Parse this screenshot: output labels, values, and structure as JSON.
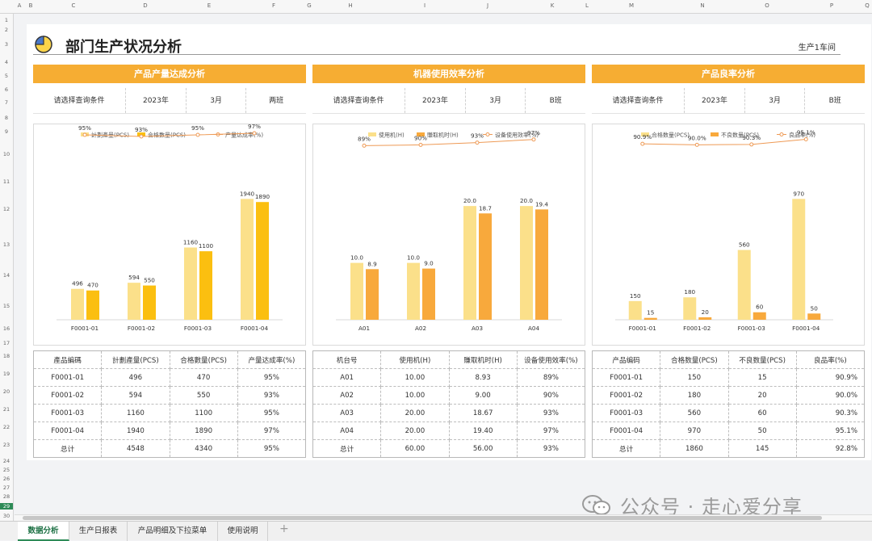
{
  "columns": [
    "A",
    "B",
    "C",
    "D",
    "E",
    "F",
    "G",
    "H",
    "I",
    "J",
    "K",
    "L",
    "M",
    "N",
    "O",
    "P",
    "Q"
  ],
  "rows": [
    "1",
    "2",
    "3",
    "4",
    "5",
    "6",
    "7",
    "8",
    "9",
    "10",
    "11",
    "12",
    "13",
    "14",
    "15",
    "16",
    "17",
    "18",
    "19",
    "20",
    "21",
    "22",
    "23",
    "24",
    "25",
    "26",
    "27",
    "28",
    "29",
    "30"
  ],
  "selected_row": "29",
  "title": "部门生产状况分析",
  "workshop": "生产1车间",
  "colors": {
    "accent": "#f6ad33",
    "bar_light": "#fbe08a",
    "bar_gold": "#fbbf10",
    "bar_orange": "#f8a93c",
    "line": "#ee9a55"
  },
  "panels": [
    {
      "header": "产品产量达成分析",
      "filters": [
        "请选择查询条件",
        "2023年",
        "3月",
        "两班"
      ],
      "table": {
        "columns": [
          "產品編碼",
          "計劃產量(PCS)",
          "合格數量(PCS)",
          "产量达成率(%)"
        ],
        "rows": [
          [
            "F0001-01",
            "496",
            "470",
            "95%"
          ],
          [
            "F0001-02",
            "594",
            "550",
            "93%"
          ],
          [
            "F0001-03",
            "1160",
            "1100",
            "95%"
          ],
          [
            "F0001-04",
            "1940",
            "1890",
            "97%"
          ],
          [
            "总计",
            "4548",
            "4340",
            "95%"
          ]
        ]
      }
    },
    {
      "header": "机器使用效率分析",
      "filters": [
        "请选择查询条件",
        "2023年",
        "3月",
        "B班"
      ],
      "table": {
        "columns": [
          "机台号",
          "使用机(H)",
          "賺取机时(H)",
          "设备使用效率(%)"
        ],
        "rows": [
          [
            "A01",
            "10.00",
            "8.93",
            "89%"
          ],
          [
            "A02",
            "10.00",
            "9.00",
            "90%"
          ],
          [
            "A03",
            "20.00",
            "18.67",
            "93%"
          ],
          [
            "A04",
            "20.00",
            "19.40",
            "97%"
          ],
          [
            "总计",
            "60.00",
            "56.00",
            "93%"
          ]
        ]
      }
    },
    {
      "header": "产品良率分析",
      "filters": [
        "请选择查询条件",
        "2023年",
        "3月",
        "B班"
      ],
      "table": {
        "columns": [
          "产品编码",
          "合格数量(PCS)",
          "不良数量(PCS)",
          "良品率(%)"
        ],
        "rows": [
          [
            "F0001-01",
            "150",
            "15",
            "90.9%"
          ],
          [
            "F0001-02",
            "180",
            "20",
            "90.0%"
          ],
          [
            "F0001-03",
            "560",
            "60",
            "90.3%"
          ],
          [
            "F0001-04",
            "970",
            "50",
            "95.1%"
          ],
          [
            "总计",
            "1860",
            "145",
            "92.8%"
          ]
        ]
      }
    }
  ],
  "chart_data": [
    {
      "type": "bar",
      "categories": [
        "F0001-01",
        "F0001-02",
        "F0001-03",
        "F0001-04"
      ],
      "series": [
        {
          "name": "計劃產量(PCS)",
          "values": [
            496,
            594,
            1160,
            1940
          ],
          "labels": [
            "496",
            "594",
            "1160",
            "1940"
          ]
        },
        {
          "name": "合格數量(PCS)",
          "values": [
            470,
            550,
            1100,
            1890
          ],
          "labels": [
            "470",
            "550",
            "1100",
            "1890"
          ]
        }
      ],
      "line_series": {
        "name": "产量达成率(%)",
        "values": [
          95,
          93,
          95,
          97
        ],
        "labels": [
          "95%",
          "93%",
          "95%",
          "97%"
        ]
      },
      "ylim": [
        0,
        2100
      ],
      "line_ylim": [
        60,
        100
      ]
    },
    {
      "type": "bar",
      "categories": [
        "A01",
        "A02",
        "A03",
        "A04"
      ],
      "series": [
        {
          "name": "使用机(H)",
          "values": [
            10.0,
            10.0,
            20.0,
            20.0
          ],
          "labels": [
            "10.0",
            "10.0",
            "20.0",
            "20.0"
          ]
        },
        {
          "name": "賺取机时(H)",
          "values": [
            8.9,
            9.0,
            18.7,
            19.4
          ],
          "labels": [
            "8.9",
            "9.0",
            "18.7",
            "19.4"
          ]
        }
      ],
      "line_series": {
        "name": "设备使用效率(%)",
        "values": [
          89,
          90,
          93,
          97
        ],
        "labels": [
          "89%",
          "90%",
          "93%",
          "97%"
        ]
      },
      "ylim": [
        0,
        23
      ],
      "line_ylim": [
        60,
        102
      ]
    },
    {
      "type": "bar",
      "categories": [
        "F0001-01",
        "F0001-02",
        "F0001-03",
        "F0001-04"
      ],
      "series": [
        {
          "name": "合格数量(PCS)",
          "values": [
            150,
            180,
            560,
            970
          ],
          "labels": [
            "150",
            "180",
            "560",
            "970"
          ]
        },
        {
          "name": "不良数量(PCS)",
          "values": [
            15,
            20,
            60,
            50
          ],
          "labels": [
            "15",
            "20",
            "60",
            "50"
          ]
        }
      ],
      "line_series": {
        "name": "良品率(%)",
        "values": [
          90.9,
          90.0,
          90.3,
          95.1
        ],
        "labels": [
          "90.9%",
          "90.0%",
          "90.3%",
          "95.1%"
        ]
      },
      "ylim": [
        0,
        1050
      ],
      "line_ylim": [
        70,
        100
      ]
    }
  ],
  "tabs": [
    "数据分析",
    "生产日报表",
    "产品明细及下拉菜单",
    "使用说明"
  ],
  "add_tab": "+",
  "watermark": "公众号 · 走心爱分享"
}
